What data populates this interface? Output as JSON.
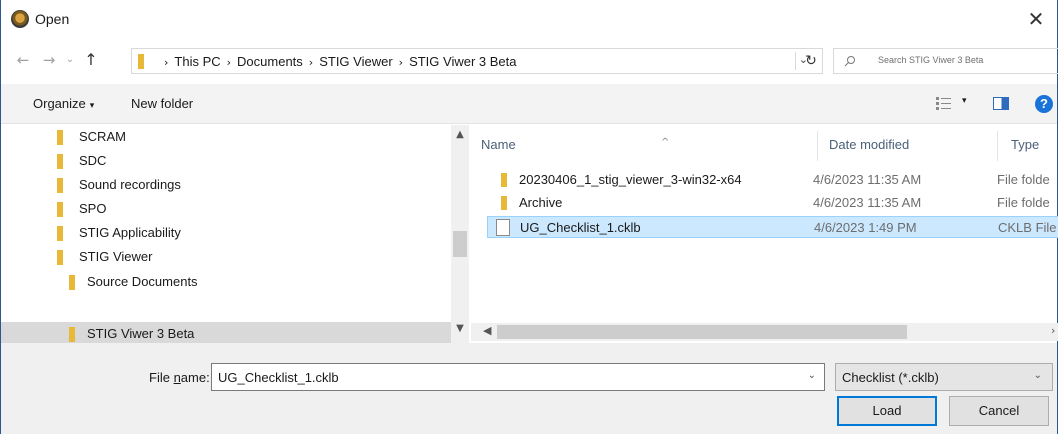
{
  "window": {
    "title": "Open"
  },
  "address": {
    "crumbs": [
      "This PC",
      "Documents",
      "STIG Viewer",
      "STIG Viwer 3 Beta"
    ],
    "search_placeholder": "Search STIG Viwer 3 Beta"
  },
  "toolbar": {
    "organize": "Organize",
    "new_folder": "New folder"
  },
  "nav": {
    "items": [
      {
        "label": "SCRAM",
        "indent": 1,
        "selected": false
      },
      {
        "label": "SDC",
        "indent": 1,
        "selected": false
      },
      {
        "label": "Sound recordings",
        "indent": 1,
        "selected": false
      },
      {
        "label": "SPO",
        "indent": 1,
        "selected": false
      },
      {
        "label": "STIG Applicability",
        "indent": 1,
        "selected": false
      },
      {
        "label": "STIG Viewer",
        "indent": 1,
        "selected": false
      },
      {
        "label": "Source Documents",
        "indent": 2,
        "selected": false
      },
      {
        "label": "STIG Viwer 3 Beta",
        "indent": 2,
        "selected": true
      }
    ]
  },
  "files": {
    "columns": {
      "name": "Name",
      "date": "Date modified",
      "type": "Type"
    },
    "rows": [
      {
        "name": "20230406_1_stig_viewer_3-win32-x64",
        "date": "4/6/2023 11:35 AM",
        "type": "File folde",
        "kind": "folder",
        "selected": false
      },
      {
        "name": "Archive",
        "date": "4/6/2023 11:35 AM",
        "type": "File folde",
        "kind": "folder",
        "selected": false
      },
      {
        "name": "UG_Checklist_1.cklb",
        "date": "4/6/2023 1:49 PM",
        "type": "CKLB File",
        "kind": "file",
        "selected": true
      }
    ]
  },
  "bottom": {
    "file_name_label_prefix": "File ",
    "file_name_label_underlined": "n",
    "file_name_label_suffix": "ame:",
    "file_name_value": "UG_Checklist_1.cklb",
    "file_type_value": "Checklist (*.cklb)",
    "load_label": "Load",
    "cancel_label": "Cancel"
  },
  "colors": {
    "accent": "#0078d7",
    "folder": "#e8b839",
    "selection": "#cce8ff"
  }
}
